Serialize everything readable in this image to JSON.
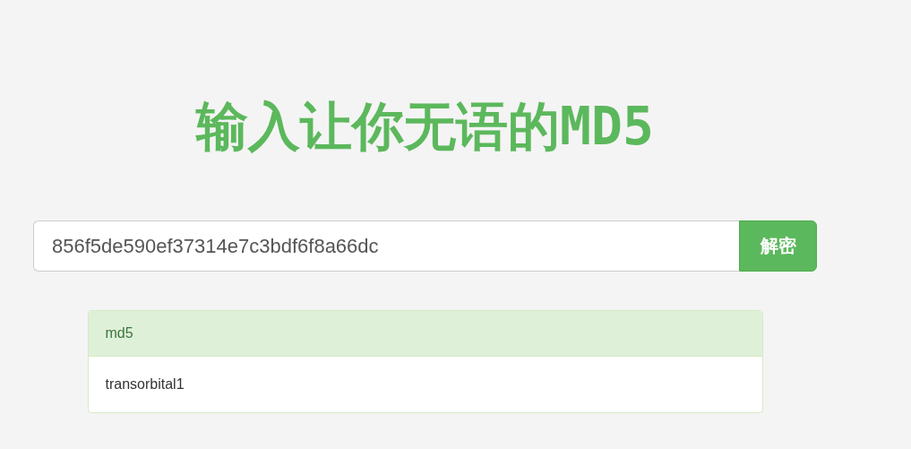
{
  "title": "输入让你无语的MD5",
  "search": {
    "value": "856f5de590ef37314e7c3bdf6f8a66dc",
    "button": "解密"
  },
  "result": {
    "heading": "md5",
    "body": "transorbital1"
  }
}
